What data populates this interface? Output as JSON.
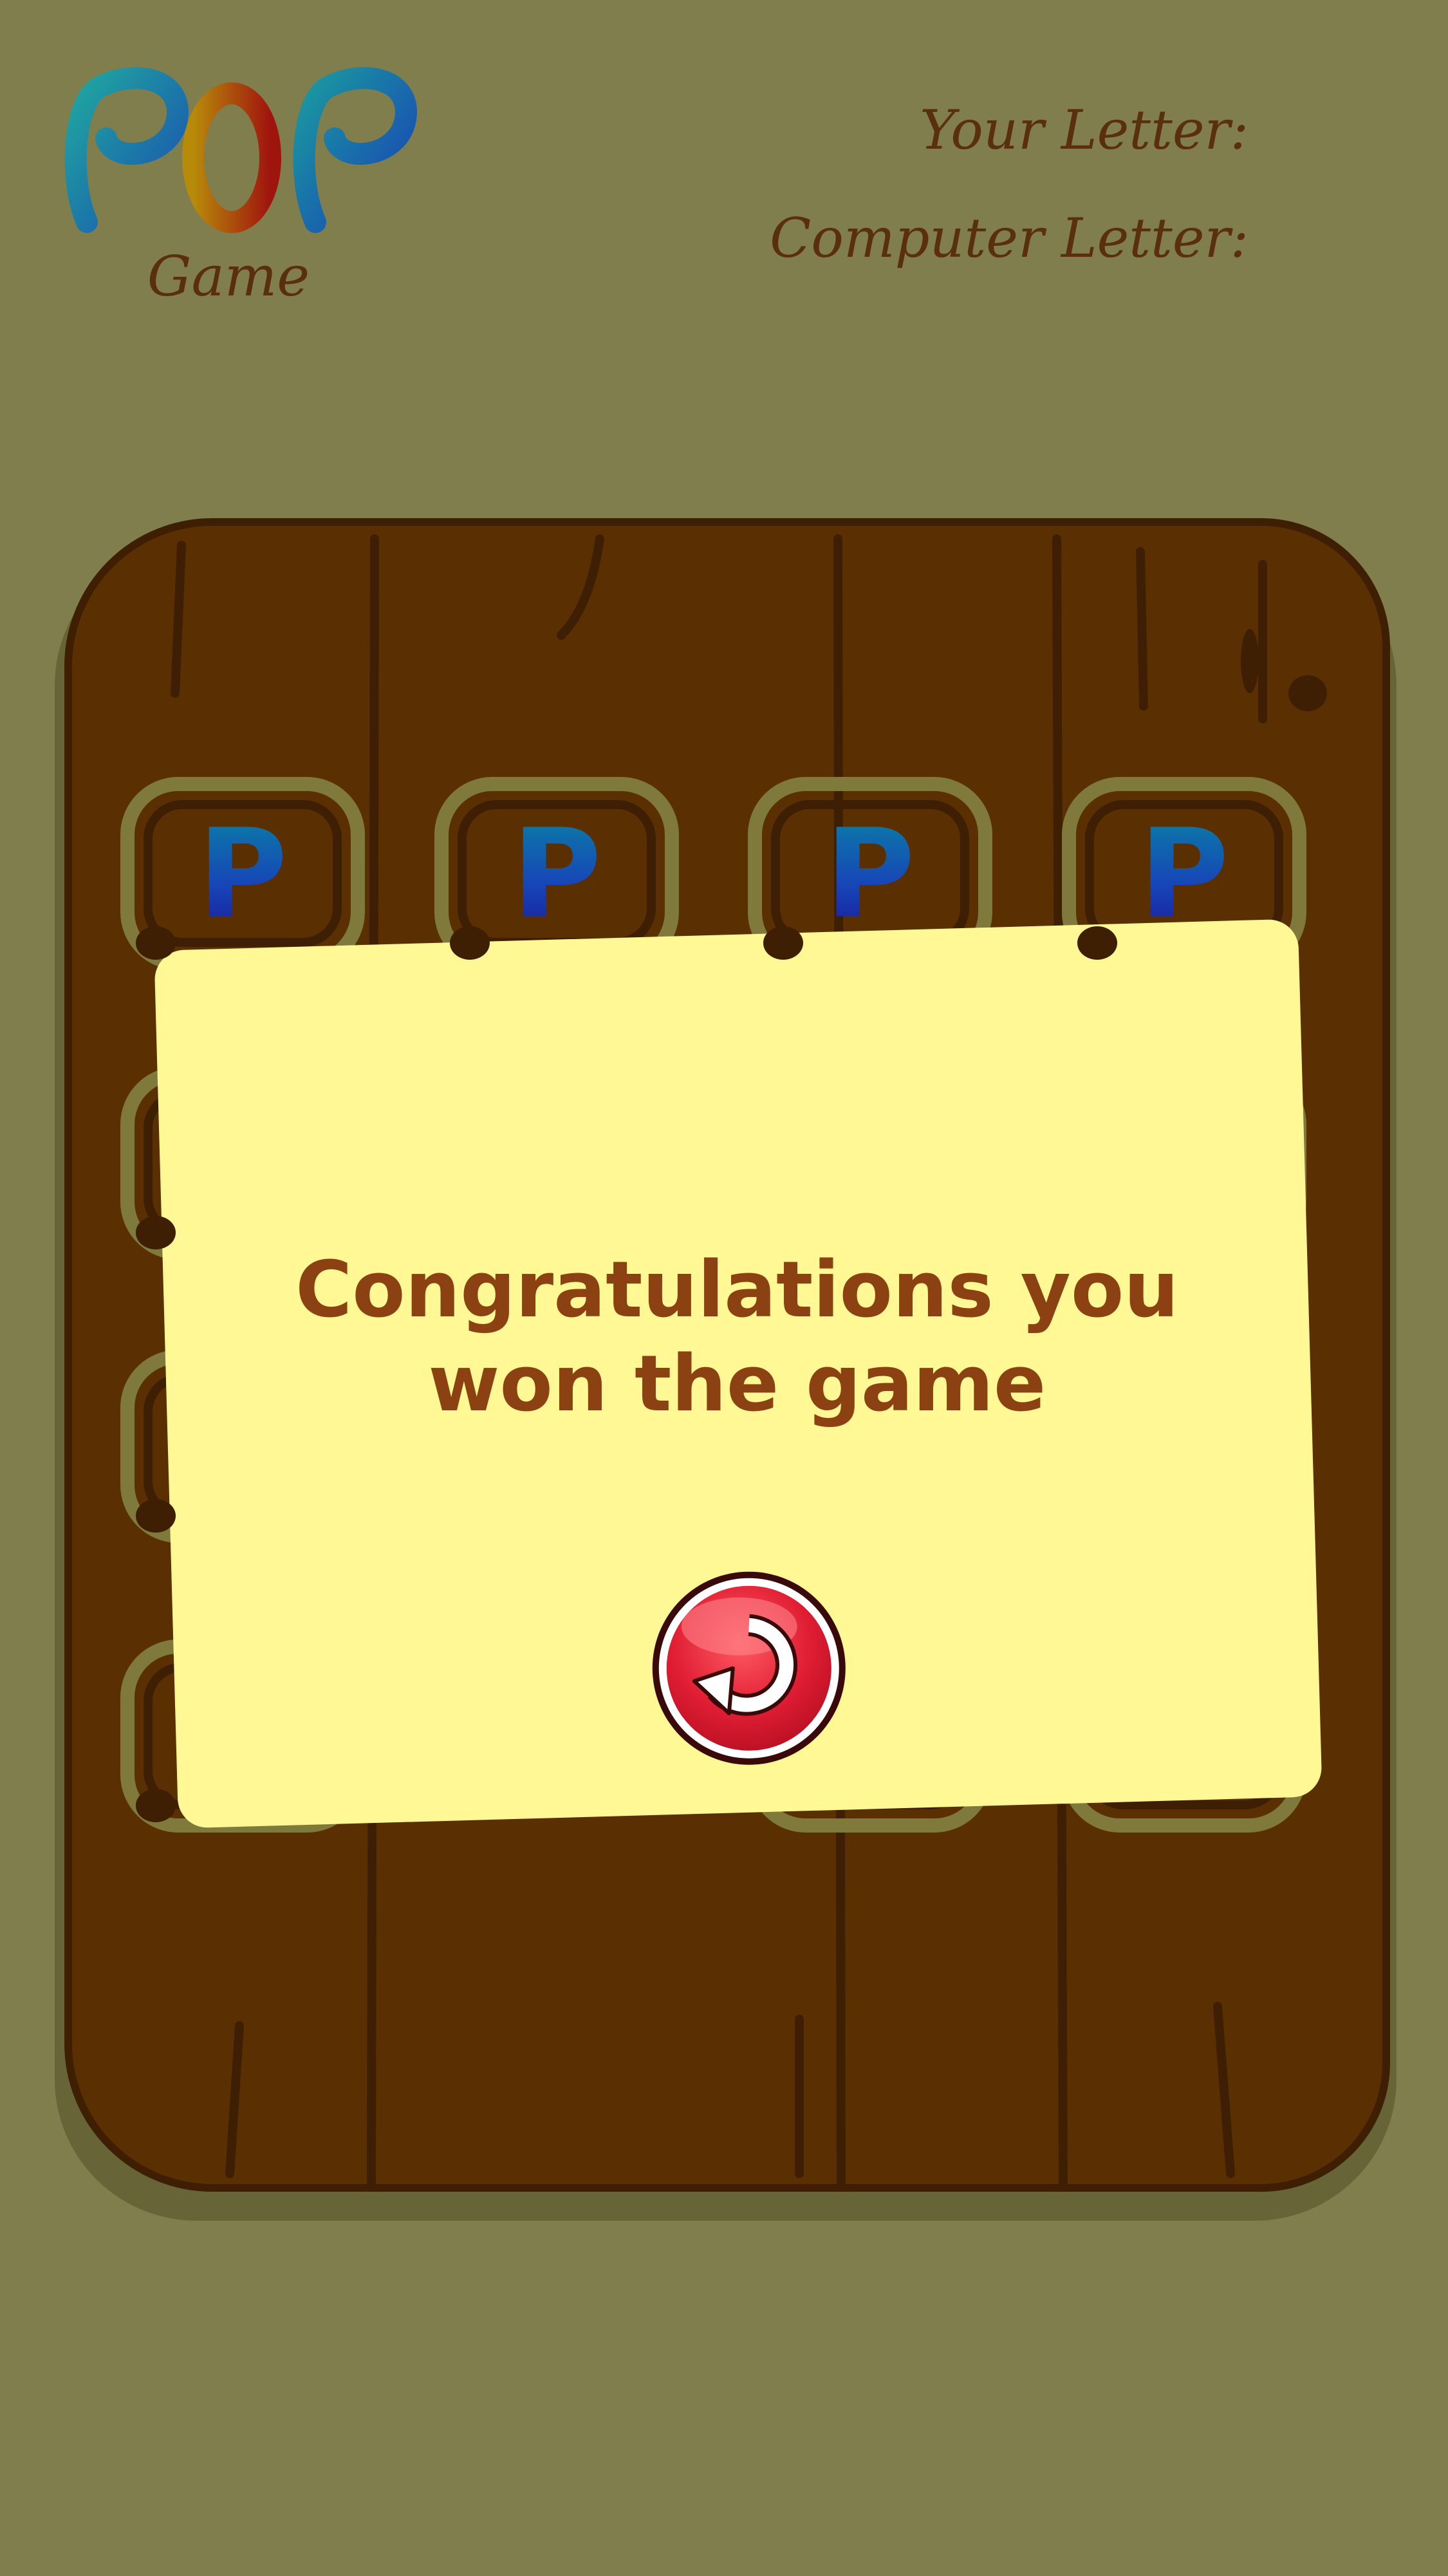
{
  "logo": {
    "title": "POP",
    "caption": "Game"
  },
  "letters": {
    "your_label": "Your Letter:",
    "computer_label": "Computer Letter:"
  },
  "board": {
    "tiles": [
      {
        "letter": "P"
      },
      {
        "letter": "P"
      },
      {
        "letter": "P"
      },
      {
        "letter": "P"
      }
    ]
  },
  "result": {
    "message": "Congratulations you won the game",
    "replay_icon": "replay-icon"
  },
  "colors": {
    "background": "#807e4c",
    "wood": "#5a3002",
    "card": "#fff894",
    "message": "#8c4112",
    "button": "#e01d33"
  }
}
